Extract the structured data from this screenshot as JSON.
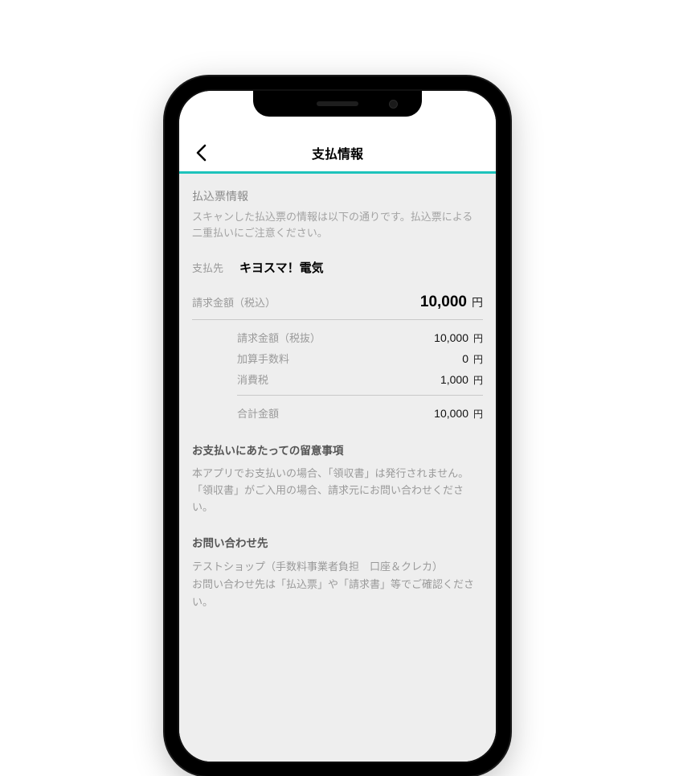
{
  "header": {
    "title": "支払情報"
  },
  "slip_info": {
    "title": "払込票情報",
    "desc": "スキャンした払込票の情報は以下の通りです。払込票による二重払いにご注意ください。"
  },
  "payee": {
    "label": "支払先",
    "value": "キヨスマ！電気"
  },
  "amounts": {
    "total": {
      "label": "請求金額（税込）",
      "value": "10,000",
      "unit": "円"
    },
    "sub": [
      {
        "label": "請求金額（税抜）",
        "value": "10,000",
        "unit": "円"
      },
      {
        "label": "加算手数料",
        "value": "0",
        "unit": "円"
      },
      {
        "label": "消費税",
        "value": "1,000",
        "unit": "円"
      }
    ],
    "grand": {
      "label": "合計金額",
      "value": "10,000",
      "unit": "円"
    }
  },
  "notes": {
    "title": "お支払いにあたっての留意事項",
    "body": "本アプリでお支払いの場合、「領収書」は発行されません。「領収書」がご入用の場合、請求元にお問い合わせください。"
  },
  "contact": {
    "title": "お問い合わせ先",
    "line1": "テストショップ（手数料事業者負担　口座＆クレカ）",
    "line2": "お問い合わせ先は「払込票」や「請求書」等でご確認ください。"
  },
  "colors": {
    "accent": "#1dc3bb"
  }
}
